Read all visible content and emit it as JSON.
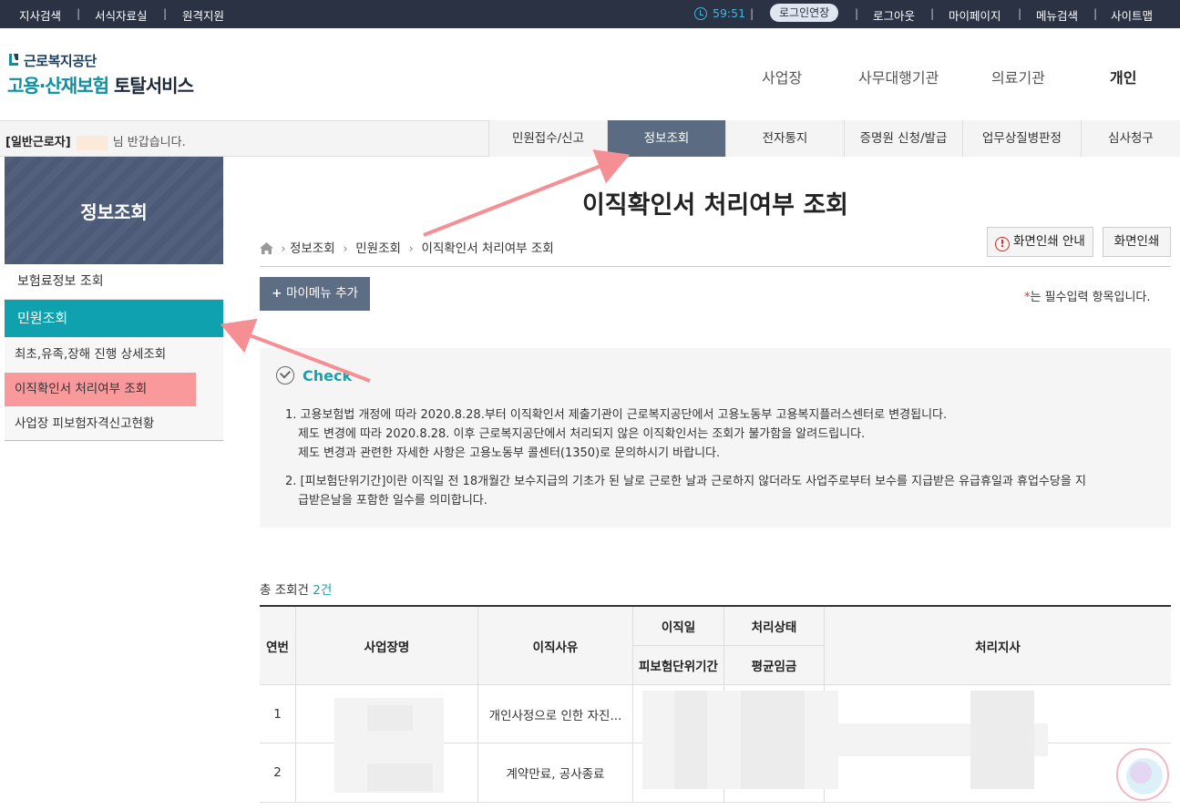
{
  "topbar": {
    "left_links": [
      "지사검색",
      "서식자료실",
      "원격지원"
    ],
    "separator": "|",
    "timer": "59:51",
    "extend_login": "로그인연장",
    "right_links": [
      "로그아웃",
      "마이페이지",
      "메뉴검색",
      "사이트맵"
    ]
  },
  "header": {
    "logo_org": "근로복지공단",
    "logo_service_accent": "고용·산재보험",
    "logo_service": "토탈서비스",
    "gnb": [
      "사업장",
      "사무대행기관",
      "의료기관",
      "개인"
    ],
    "gnb_active": "개인"
  },
  "subbar": {
    "user_type": "[일반근로자]",
    "greeting_suffix": "님 반갑습니다.",
    "menu": [
      "민원접수/신고",
      "정보조회",
      "전자통지",
      "증명원 신청/발급",
      "업무상질병판정",
      "심사청구"
    ],
    "active": "정보조회"
  },
  "lnb": {
    "title": "정보조회",
    "items": [
      "보험료정보 조회",
      "민원조회"
    ],
    "sub_items": [
      "최초,유족,장해 진행 상세조회",
      "이직확인서 처리여부 조회",
      "사업장 피보험자격신고현황"
    ],
    "highlight": "이직확인서 처리여부 조회"
  },
  "main": {
    "title": "이직확인서 처리여부 조회",
    "breadcrumb": [
      "정보조회",
      "민원조회",
      "이직확인서 처리여부 조회"
    ],
    "print_guide": "화면인쇄 안내",
    "print": "화면인쇄",
    "my_menu_add": "마이메뉴 추가",
    "required_mark": "*",
    "required_text": "는 필수입력 항목입니다.",
    "check": {
      "title": "Check",
      "notes": [
        [
          "1. 고용보험법 개정에 따라 2020.8.28.부터 이직확인서 제출기관이 근로복지공단에서 고용노동부 고용복지플러스센터로 변경됩니다.",
          "제도 변경에 따라 2020.8.28. 이후 근로복지공단에서 처리되지 않은 이직확인서는 조회가 불가함을 알려드립니다.",
          "제도 변경과 관련한 자세한 사항은 고용노동부 콜센터(1350)로 문의하시기 바랍니다."
        ],
        [
          "2. [피보험단위기간]이란 이직일 전 18개월간 보수지급의 기초가 된 날로 근로한 날과 근로하지 않더라도 사업주로부터 보수를 지급받은 유급휴일과 휴업수당을 지",
          "급받은날을 포함한 일수를 의미합니다."
        ]
      ]
    },
    "total_label": "총 조회건",
    "total_count": "2건",
    "table": {
      "headers": {
        "no": "연번",
        "company": "사업장명",
        "reason": "이직사유",
        "leave_date": "이직일",
        "status": "처리상태",
        "branch": "처리지사",
        "insured_period": "피보험단위기간",
        "avg_wage": "평균임금"
      },
      "rows": [
        {
          "no": "1",
          "reason": "개인사정으로 인한 자진..."
        },
        {
          "no": "2",
          "reason": "계약만료, 공사종료"
        }
      ]
    }
  }
}
